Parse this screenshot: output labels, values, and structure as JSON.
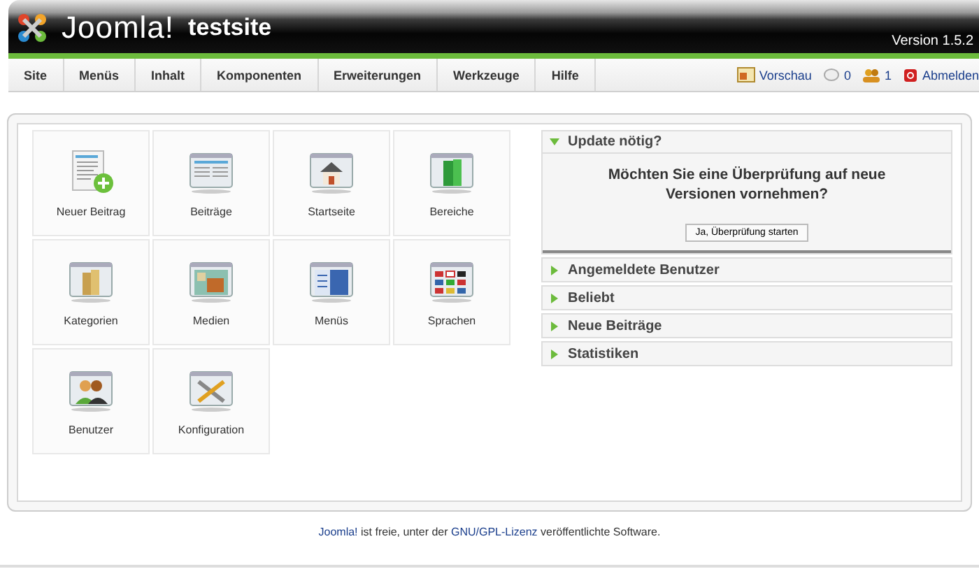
{
  "header": {
    "logo": "Joomla!",
    "site": "testsite",
    "version": "Version 1.5.2"
  },
  "menu": [
    {
      "label": "Site"
    },
    {
      "label": "Menüs"
    },
    {
      "label": "Inhalt"
    },
    {
      "label": "Komponenten"
    },
    {
      "label": "Erweiterungen"
    },
    {
      "label": "Werkzeuge"
    },
    {
      "label": "Hilfe"
    }
  ],
  "status": [
    {
      "kind": "preview",
      "label": "Vorschau"
    },
    {
      "kind": "messages",
      "label": "0"
    },
    {
      "kind": "users",
      "label": "1"
    },
    {
      "kind": "logout",
      "label": "Abmelden"
    }
  ],
  "shortcuts": [
    {
      "kind": "new-article",
      "label": "Neuer Beitrag"
    },
    {
      "kind": "articles",
      "label": "Beiträge"
    },
    {
      "kind": "home",
      "label": "Startseite"
    },
    {
      "kind": "sections",
      "label": "Bereiche"
    },
    {
      "kind": "categories",
      "label": "Kategorien"
    },
    {
      "kind": "media",
      "label": "Medien"
    },
    {
      "kind": "menus",
      "label": "Menüs"
    },
    {
      "kind": "languages",
      "label": "Sprachen"
    },
    {
      "kind": "users",
      "label": "Benutzer"
    },
    {
      "kind": "config",
      "label": "Konfiguration"
    }
  ],
  "panels": [
    {
      "title": "Update nötig?",
      "expanded": true,
      "question": "Möchten Sie eine Überprüfung auf neue Versionen vornehmen?",
      "button": "Ja, Überprüfung starten"
    },
    {
      "title": "Angemeldete Benutzer",
      "expanded": false
    },
    {
      "title": "Beliebt",
      "expanded": false
    },
    {
      "title": "Neue Beiträge",
      "expanded": false
    },
    {
      "title": "Statistiken",
      "expanded": false
    }
  ],
  "footer": {
    "link1": "Joomla!",
    "text1": "ist freie, unter der",
    "link2": "GNU/GPL-Lizenz",
    "text2": "veröffentlichte Software."
  }
}
